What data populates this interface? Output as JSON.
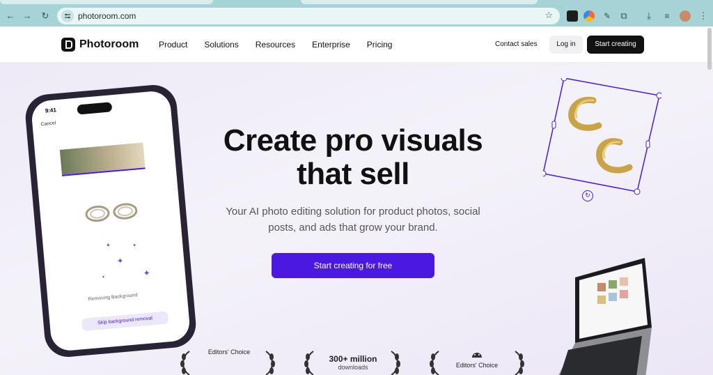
{
  "browser": {
    "url": "photoroom.com"
  },
  "header": {
    "logo_text": "Photoroom",
    "nav": [
      "Product",
      "Solutions",
      "Resources",
      "Enterprise",
      "Pricing"
    ],
    "contact_sales": "Contact sales",
    "login": "Log in",
    "start_creating": "Start creating"
  },
  "hero": {
    "headline_line1": "Create pro visuals",
    "headline_line2": "that sell",
    "subhead_line1": "Your AI photo editing solution for product photos, social",
    "subhead_line2": "posts, and ads that grow your brand.",
    "cta": "Start creating for free"
  },
  "phone": {
    "time": "9:41",
    "cancel": "Cancel",
    "status": "Removing Background",
    "skip": "Skip background removal"
  },
  "awards": [
    {
      "label": "Editors' Choice",
      "icon": "apple-icon"
    },
    {
      "big": "300+ million",
      "small": "downloads"
    },
    {
      "label": "Editors' Choice",
      "icon": "android-icon"
    }
  ],
  "colors": {
    "accent": "#4a18e0",
    "chrome": "#a6d3d5"
  }
}
